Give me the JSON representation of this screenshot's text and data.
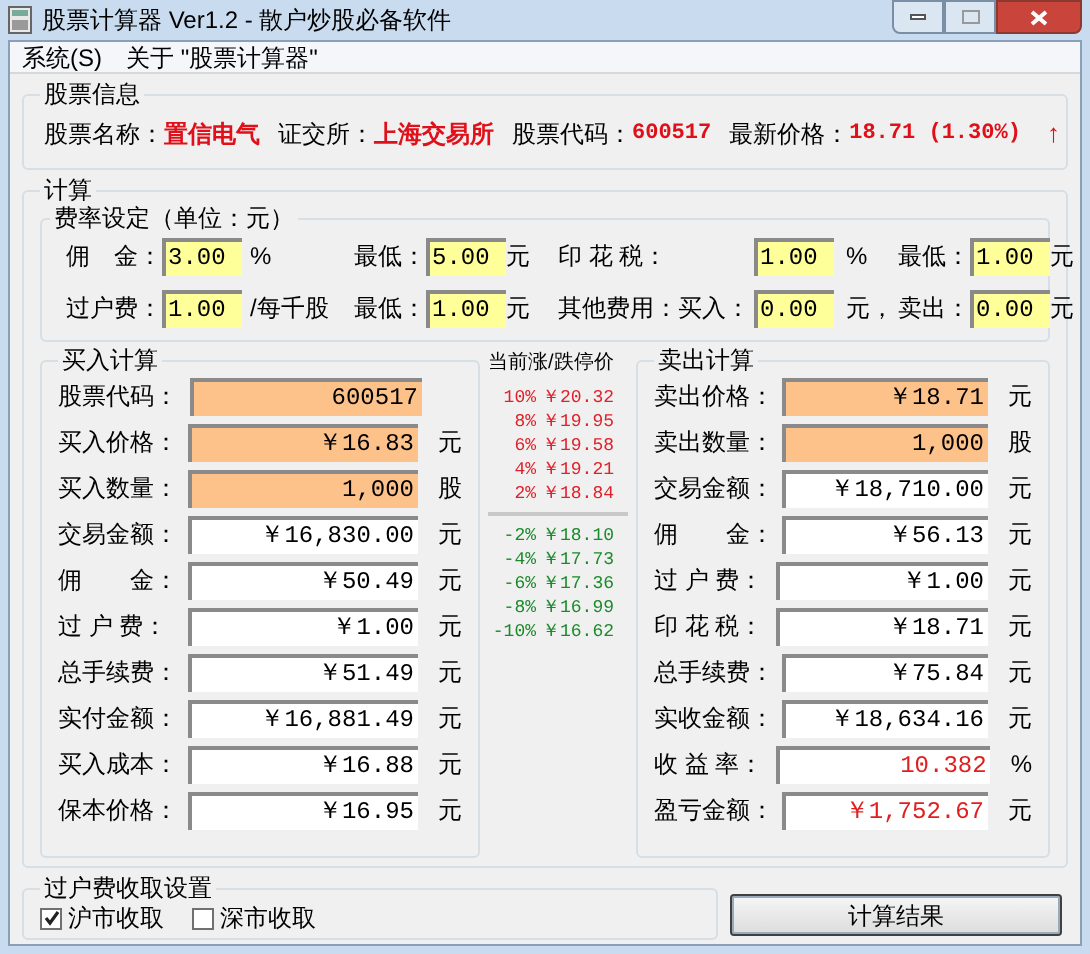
{
  "window": {
    "title": "股票计算器 Ver1.2 - 散户炒股必备软件"
  },
  "menu": [
    "系统(S)",
    "关于 \"股票计算器\""
  ],
  "stock_info": {
    "title": "股票信息",
    "fields": [
      {
        "label": "股票名称：",
        "value": "置信电气",
        "kind": "name"
      },
      {
        "label": "证交所：",
        "value": "上海交易所",
        "kind": "name"
      },
      {
        "label": "股票代码：",
        "value": "600517",
        "kind": "code"
      },
      {
        "label": "最新价格：",
        "value": "18.71 (1.30%)",
        "kind": "code"
      }
    ],
    "trend": "↑"
  },
  "calculation": {
    "title": "计算",
    "fee_settings": {
      "title": "费率设定（单位：元）",
      "rows": [
        [
          {
            "kind": "label",
            "text": "佣　金："
          },
          {
            "kind": "input",
            "text": "3.00"
          },
          {
            "kind": "label",
            "text": "%"
          },
          {
            "kind": "label",
            "text": "最低："
          },
          {
            "kind": "input",
            "text": "5.00"
          },
          {
            "kind": "label",
            "text": "元"
          },
          {
            "kind": "label",
            "text": "印 花 税："
          },
          {
            "kind": "input",
            "text": "1.00"
          },
          {
            "kind": "label",
            "text": "%"
          },
          {
            "kind": "label",
            "text": "最低："
          },
          {
            "kind": "input",
            "text": "1.00"
          },
          {
            "kind": "label",
            "text": "元"
          }
        ],
        [
          {
            "kind": "label",
            "text": "过户费："
          },
          {
            "kind": "input",
            "text": "1.00"
          },
          {
            "kind": "label",
            "text": "/每千股"
          },
          {
            "kind": "label",
            "text": "最低："
          },
          {
            "kind": "input",
            "text": "1.00"
          },
          {
            "kind": "label",
            "text": "元"
          },
          {
            "kind": "label",
            "text": "其他费用：买入："
          },
          {
            "kind": "input",
            "text": "0.00"
          },
          {
            "kind": "label",
            "text": "元，"
          },
          {
            "kind": "label",
            "text": "卖出："
          },
          {
            "kind": "input",
            "text": "0.00"
          },
          {
            "kind": "label",
            "text": "元"
          }
        ]
      ]
    },
    "buy": {
      "title": "买入计算",
      "rows": [
        {
          "label": "股票代码：",
          "value": "600517",
          "unit": "",
          "kind": "input"
        },
        {
          "label": "买入价格：",
          "value": "￥16.83",
          "unit": "元",
          "kind": "input"
        },
        {
          "label": "买入数量：",
          "value": "1,000",
          "unit": "股",
          "kind": "input"
        },
        {
          "label": "交易金额：",
          "value": "￥16,830.00",
          "unit": "元",
          "kind": "output"
        },
        {
          "label": "佣　　金：",
          "value": "￥50.49",
          "unit": "元",
          "kind": "output"
        },
        {
          "label": "过 户 费：",
          "value": "￥1.00",
          "unit": "元",
          "kind": "output"
        },
        {
          "label": "总手续费：",
          "value": "￥51.49",
          "unit": "元",
          "kind": "output"
        },
        {
          "label": "实付金额：",
          "value": "￥16,881.49",
          "unit": "元",
          "kind": "output"
        },
        {
          "label": "买入成本：",
          "value": "￥16.88",
          "unit": "元",
          "kind": "output"
        },
        {
          "label": "保本价格：",
          "value": "￥16.95",
          "unit": "元",
          "kind": "output"
        }
      ]
    },
    "limits": {
      "title": "当前涨/跌停价",
      "up": [
        {
          "pct": "10%",
          "price": "￥20.32"
        },
        {
          "pct": "8%",
          "price": "￥19.95"
        },
        {
          "pct": "6%",
          "price": "￥19.58"
        },
        {
          "pct": "4%",
          "price": "￥19.21"
        },
        {
          "pct": "2%",
          "price": "￥18.84"
        }
      ],
      "down": [
        {
          "pct": "-2%",
          "price": "￥18.10"
        },
        {
          "pct": "-4%",
          "price": "￥17.73"
        },
        {
          "pct": "-6%",
          "price": "￥17.36"
        },
        {
          "pct": "-8%",
          "price": "￥16.99"
        },
        {
          "pct": "-10%",
          "price": "￥16.62"
        }
      ]
    },
    "sell": {
      "title": "卖出计算",
      "rows": [
        {
          "label": "卖出价格：",
          "value": "￥18.71",
          "unit": "元",
          "kind": "input"
        },
        {
          "label": "卖出数量：",
          "value": "1,000",
          "unit": "股",
          "kind": "input"
        },
        {
          "label": "交易金额：",
          "value": "￥18,710.00",
          "unit": "元",
          "kind": "output"
        },
        {
          "label": "佣　　金：",
          "value": "￥56.13",
          "unit": "元",
          "kind": "output"
        },
        {
          "label": "过 户 费：",
          "value": "￥1.00",
          "unit": "元",
          "kind": "output"
        },
        {
          "label": "印 花 税：",
          "value": "￥18.71",
          "unit": "元",
          "kind": "output"
        },
        {
          "label": "总手续费：",
          "value": "￥75.84",
          "unit": "元",
          "kind": "output"
        },
        {
          "label": "实收金额：",
          "value": "￥18,634.16",
          "unit": "元",
          "kind": "output"
        },
        {
          "label": "收 益 率：",
          "value": "10.382",
          "unit": "%",
          "kind": "result"
        },
        {
          "label": "盈亏金额：",
          "value": "￥1,752.67",
          "unit": "元",
          "kind": "result"
        }
      ]
    }
  },
  "transfer_fee": {
    "title": "过户费收取设置",
    "options": [
      {
        "label": "沪市收取",
        "checked": true
      },
      {
        "label": "深市收取",
        "checked": false
      }
    ]
  },
  "buttons": [
    "计算结果"
  ]
}
